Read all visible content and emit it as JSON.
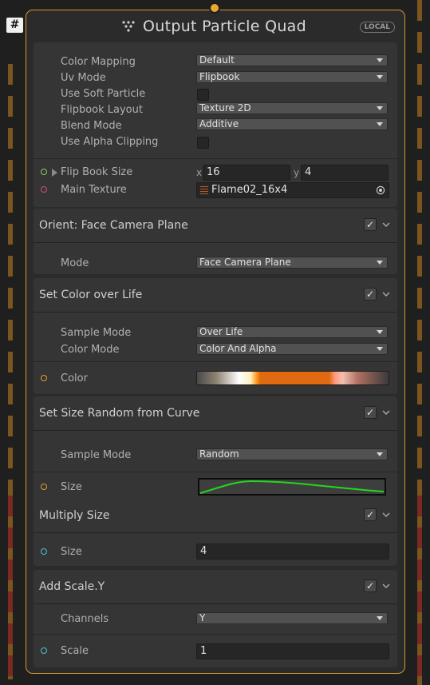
{
  "node": {
    "badge": "#",
    "title": "Output Particle Quad",
    "local_badge": "LOCAL"
  },
  "settings": {
    "color_mapping": {
      "label": "Color Mapping",
      "value": "Default"
    },
    "uv_mode": {
      "label": "Uv Mode",
      "value": "Flipbook"
    },
    "use_soft_particle": {
      "label": "Use Soft Particle",
      "checked": false
    },
    "flipbook_layout": {
      "label": "Flipbook Layout",
      "value": "Texture 2D"
    },
    "blend_mode": {
      "label": "Blend Mode",
      "value": "Additive"
    },
    "use_alpha_clipping": {
      "label": "Use Alpha Clipping",
      "checked": false
    }
  },
  "inputs": {
    "flip_book_size": {
      "label": "Flip Book Size",
      "x_axis": "x",
      "x": "16",
      "y_axis": "y",
      "y": "4"
    },
    "main_texture": {
      "label": "Main Texture",
      "value": "Flame02_16x4"
    }
  },
  "blocks": {
    "orient": {
      "title": "Orient: Face Camera Plane",
      "check": "✓",
      "mode_label": "Mode",
      "mode_value": "Face Camera Plane"
    },
    "color_over_life": {
      "title": "Set Color over Life",
      "check": "✓",
      "sample_mode_label": "Sample Mode",
      "sample_mode_value": "Over Life",
      "color_mode_label": "Color Mode",
      "color_mode_value": "Color And Alpha",
      "color_label": "Color"
    },
    "size_random": {
      "title": "Set Size Random from Curve",
      "check": "✓",
      "sample_mode_label": "Sample Mode",
      "sample_mode_value": "Random",
      "size_label": "Size"
    },
    "multiply_size": {
      "title": "Multiply Size",
      "check": "✓",
      "size_label": "Size",
      "size_value": "4"
    },
    "add_scale_y": {
      "title": "Add Scale.Y",
      "check": "✓",
      "channels_label": "Channels",
      "channels_value": "Y",
      "scale_label": "Scale",
      "scale_value": "1"
    }
  },
  "colors": {
    "node_border_top": "#d09a2a",
    "node_border_bottom": "#d2552a",
    "gradient_orange": "#e06a12",
    "curve_green": "#22d81e"
  },
  "icons": {
    "title": "particle-dots-icon",
    "texture": "texture-icon",
    "object_picker": "target-icon"
  }
}
